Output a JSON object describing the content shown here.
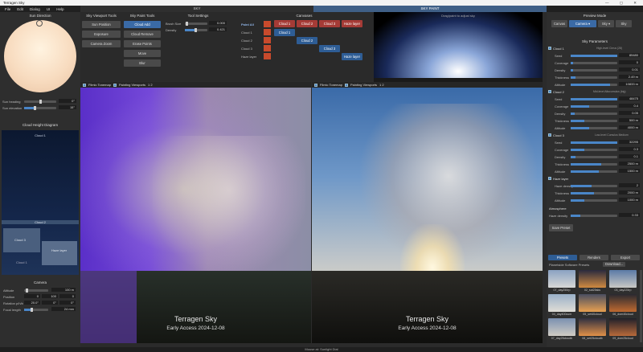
{
  "window": {
    "title": "Terragen Sky",
    "controls": "—  ▢  ✕"
  },
  "menu": [
    "File",
    "Edit",
    "Dialog",
    "UI",
    "Help"
  ],
  "main_tabs": [
    {
      "label": "SKY",
      "active": false
    },
    {
      "label": "SKY PAINT",
      "active": true
    }
  ],
  "sun_direction": {
    "header": "Sun Direction",
    "heading_label": "Sun heading",
    "heading_value": "0°",
    "elevation_label": "Sun elevation",
    "elevation_value": "15°"
  },
  "cloud_height": {
    "header": "Cloud Height Diagram",
    "top_label": "Cloud 1",
    "layer_label": "Cloud 2",
    "box_labels": [
      "Cloud 3",
      "Haze layer",
      "Cloud 1"
    ]
  },
  "camera": {
    "header": "Camera",
    "altitude_label": "Altitude",
    "altitude_value": "100 m",
    "position_label": "Position",
    "position_values": [
      "0",
      "100",
      "0"
    ],
    "rotation_label": "Rotation p/h/b",
    "rotation_values": [
      "20.0°",
      "0°",
      "0°"
    ],
    "focal_label": "Focal length",
    "focal_value": "24 mm"
  },
  "viewport_tools": {
    "header": "Sky Viewport Tools",
    "buttons": [
      "Sun Position",
      "Exposure",
      "Camera Zoom"
    ]
  },
  "paint_tools": {
    "header": "Sky Paint Tools",
    "buttons": [
      "Cloud Add",
      "Cloud Remove",
      "Erase Points",
      "Move",
      "Blur"
    ]
  },
  "tool_settings": {
    "header": "Tool Settings",
    "brush_label": "Brush Size",
    "brush_value": "0.000",
    "density_label": "Density",
    "density_value": "0.421"
  },
  "canvases": {
    "header": "Canvases",
    "row_labels": [
      "Paint All",
      "Cloud 1",
      "Cloud 2",
      "Cloud 3",
      "Haze layer"
    ],
    "cells": [
      "Cloud 1",
      "Cloud 2",
      "Cloud 3",
      "Haze layer"
    ]
  },
  "preview_strip": {
    "label": "Drag/paint to adjust sky"
  },
  "viewports": {
    "left": {
      "filmic": "Filmic Tonemap",
      "painting": "Painting Viewports",
      "nums": "1  2",
      "brand": "Terragen Sky",
      "version": "Early Access 2024-12-08"
    },
    "right": {
      "filmic": "Filmic Tonemap",
      "painting": "Painting Viewports",
      "nums": "1  2",
      "brand": "Terragen Sky",
      "version": "Early Access 2024-12-08"
    }
  },
  "preview_mode": {
    "header": "Preview Mode",
    "buttons": [
      "Canvas",
      "Camera ▾",
      "Sky ▾",
      "Sky"
    ]
  },
  "sky_params": {
    "header": "Sky Parameters",
    "clouds": [
      {
        "name": "Cloud 1",
        "note": "High-level Cirrus (28)",
        "rows": [
          {
            "label": "Seed",
            "value": "85480",
            "fill": 1.0
          },
          {
            "label": "Coverage",
            "value": "0",
            "fill": 0.05
          },
          {
            "label": "Density",
            "value": "0.01",
            "fill": 0.05
          },
          {
            "label": "Thickness",
            "value": "2.49 m",
            "fill": 0.1
          },
          {
            "label": "Altitude",
            "value": "10833 m",
            "fill": 0.85
          }
        ]
      },
      {
        "name": "Cloud 2",
        "note": "Mid-level Altocumulus (big)",
        "rows": [
          {
            "label": "Seed",
            "value": "48475",
            "fill": 1.0
          },
          {
            "label": "Coverage",
            "value": "0.4",
            "fill": 0.4
          },
          {
            "label": "Density",
            "value": "0.05",
            "fill": 0.08
          },
          {
            "label": "Thickness",
            "value": "500 m",
            "fill": 0.3
          },
          {
            "label": "Altitude",
            "value": "4000 m",
            "fill": 0.4
          }
        ]
      },
      {
        "name": "Cloud 3",
        "note": "Low-level Cumulus Medium",
        "rows": [
          {
            "label": "Seed",
            "value": "32295",
            "fill": 1.0
          },
          {
            "label": "Coverage",
            "value": "0.3",
            "fill": 0.3
          },
          {
            "label": "Density",
            "value": "0.1",
            "fill": 0.1
          },
          {
            "label": "Thickness",
            "value": "2500 m",
            "fill": 0.65
          },
          {
            "label": "Altitude",
            "value": "1500 m",
            "fill": 0.6
          }
        ]
      }
    ],
    "haze": {
      "name": "Haze layer",
      "rows": [
        {
          "label": "Haze density",
          "value": "2",
          "fill": 0.45
        },
        {
          "label": "Thickness",
          "value": "2000 m",
          "fill": 0.5
        },
        {
          "label": "Altitude",
          "value": "1000 m",
          "fill": 0.3
        }
      ]
    },
    "atmosphere": {
      "header": "Atmosphere",
      "label": "Haze density",
      "value": "0.33",
      "fill": 0.2
    },
    "save_preset": "Save Preset"
  },
  "presets": {
    "tabs": [
      "Presets",
      "Renders",
      "Export"
    ],
    "source": "Planetside Software Presets",
    "download": "Download...",
    "items": [
      "07_day250rp",
      "02_sat25sks",
      "03_day225rp",
      "04_day400cum",
      "05_set40cloud",
      "06_dom40cloud",
      "07_day25cloudb",
      "08_set25cloudb",
      "09_dom25cloud"
    ],
    "tags": [
      "8K",
      "8K",
      "8K",
      "8K",
      "8K",
      "8K",
      "8K",
      "8K",
      "8K"
    ]
  },
  "status": {
    "text": "Mouse at: Sunlight Dial"
  },
  "colors": {
    "accent": "#3a6aa6",
    "red": "#a53b36",
    "bg": "#2b2b2b"
  }
}
